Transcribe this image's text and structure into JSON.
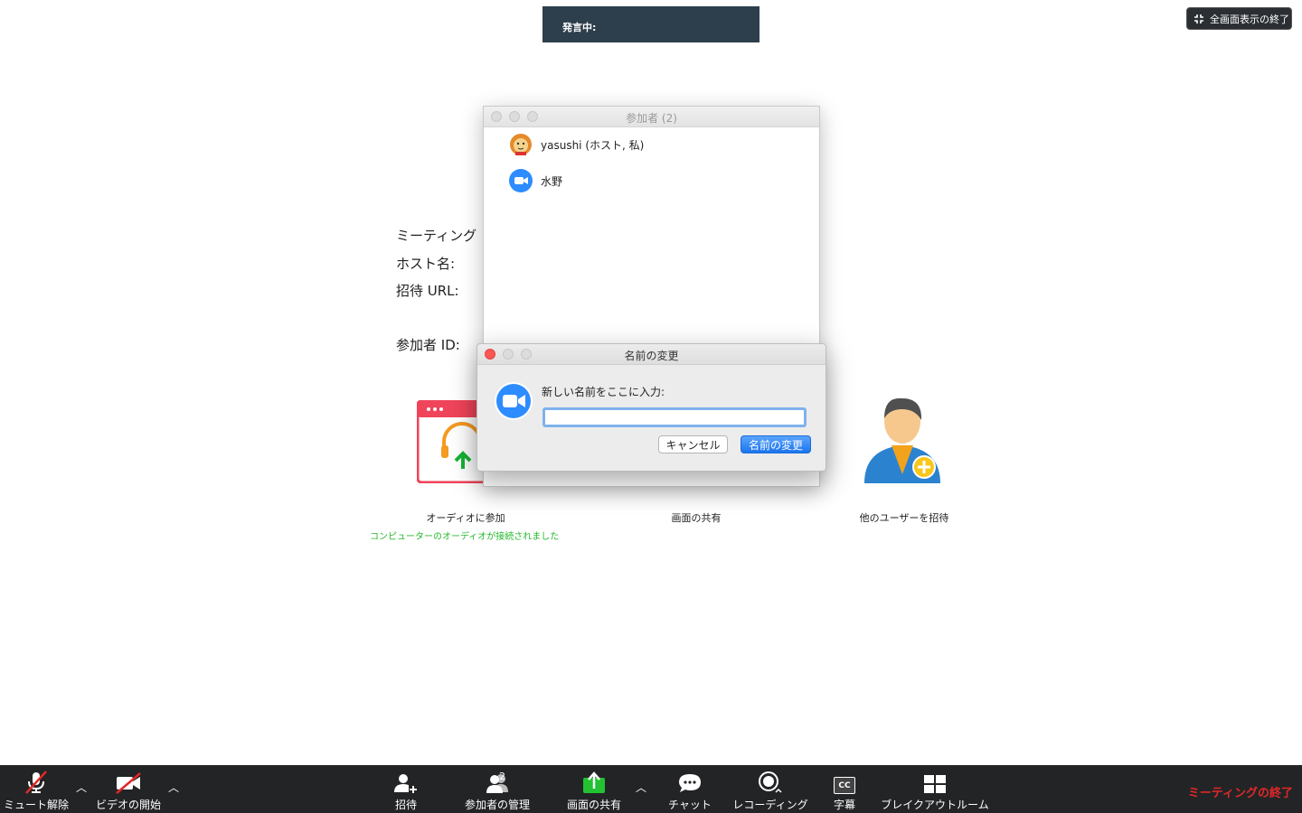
{
  "banner": {
    "speaking_label": "発言中:"
  },
  "exit_fullscreen": {
    "label": "全画面表示の終了"
  },
  "meeting_info": {
    "meeting_label": "ミーティング",
    "host_label": "ホスト名:",
    "invite_url_label": "招待 URL:",
    "participant_id_label": "参加者 ID:"
  },
  "tiles": {
    "audio": {
      "label": "オーディオに参加",
      "status": "コンピューターのオーディオが接続されました"
    },
    "share": {
      "label": "画面の共有"
    },
    "invite": {
      "label": "他のユーザーを招待"
    }
  },
  "participants_window": {
    "title": "参加者 (2)",
    "items": [
      {
        "name": "yasushi (ホスト, 私)",
        "avatar": "lion-avatar-icon"
      },
      {
        "name": "水野",
        "avatar": "zoom-camera-icon"
      }
    ]
  },
  "rename_dialog": {
    "title": "名前の変更",
    "prompt": "新しい名前をここに入力:",
    "input_value": "",
    "cancel_label": "キャンセル",
    "ok_label": "名前の変更"
  },
  "toolbar": {
    "unmute": "ミュート解除",
    "start_video": "ビデオの開始",
    "invite": "招待",
    "participants": "参加者の管理",
    "participants_count": "2",
    "share_screen": "画面の共有",
    "chat": "チャット",
    "recording": "レコーディング",
    "captions": "字幕",
    "cc_text": "CC",
    "breakout": "ブレイクアウトルーム",
    "end_meeting": "ミーティングの終了"
  },
  "colors": {
    "banner_bg": "#2d3e4c",
    "toolbar_bg": "#232426",
    "end_red": "#e02828",
    "audio_green": "#25b82b",
    "zoom_blue": "#2d8cff",
    "share_green": "#22c232"
  }
}
